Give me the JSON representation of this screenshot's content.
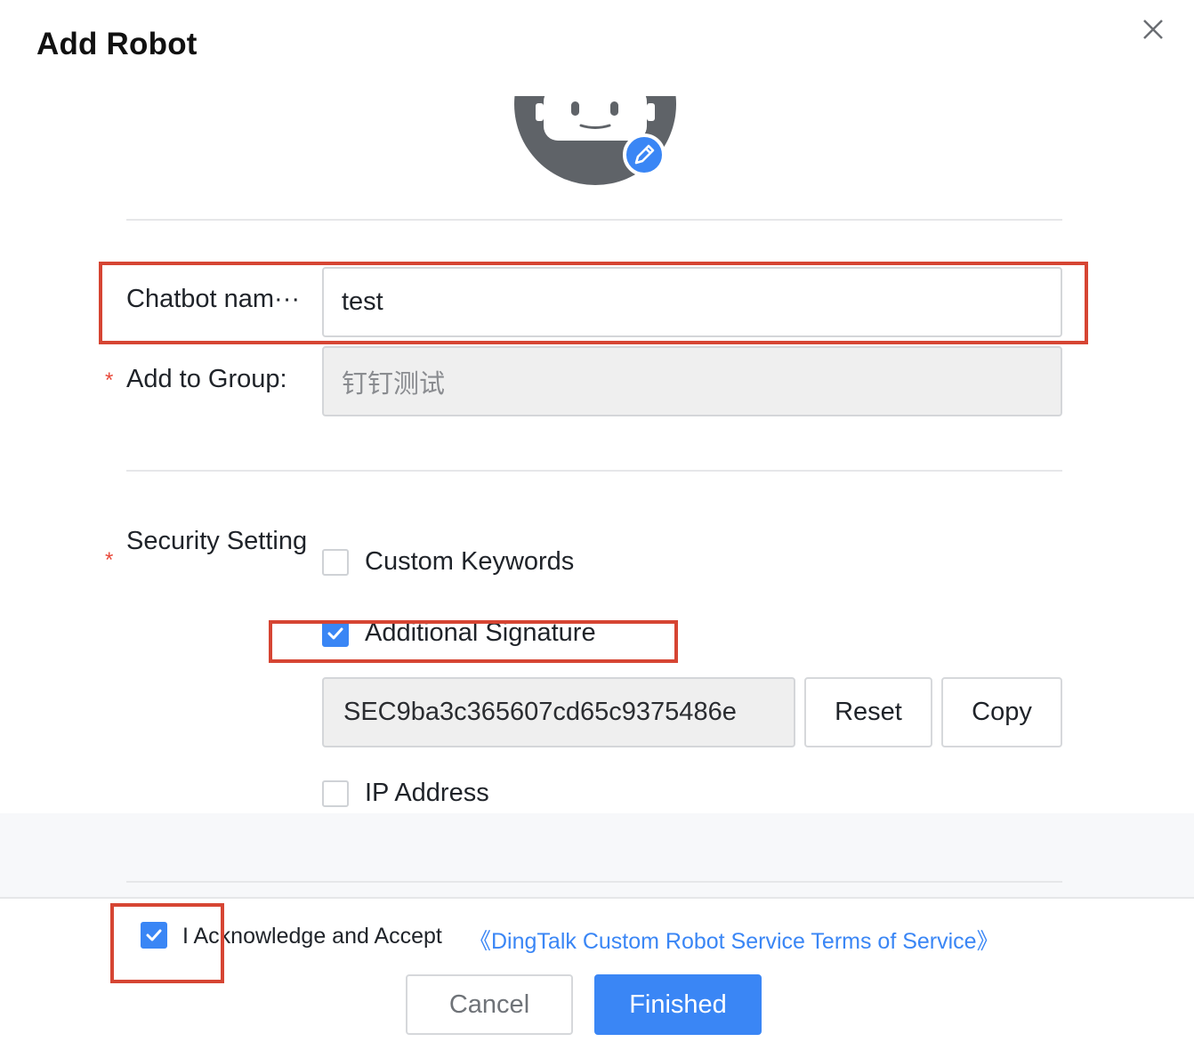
{
  "dialog": {
    "title": "Add Robot",
    "close_icon": "close-icon"
  },
  "avatar": {
    "icon": "robot-avatar-icon",
    "edit_icon": "pencil-icon"
  },
  "form": {
    "name_label": "Chatbot nam···",
    "name_value": "test",
    "group_label": "Add to Group:",
    "group_value": "钉钉测试",
    "security_label": "Security Setting",
    "required_mark": "*"
  },
  "security": {
    "options": [
      {
        "label": "Custom Keywords",
        "checked": false
      },
      {
        "label": "Additional Signature",
        "checked": true
      },
      {
        "label": "IP Address",
        "checked": false
      }
    ],
    "secret_value": "SEC9ba3c365607cd65c9375486e",
    "reset_label": "Reset",
    "copy_label": "Copy"
  },
  "footer": {
    "ack_checked": true,
    "ack_text": "I Acknowledge and Accept",
    "ack_link": "《DingTalk Custom Robot Service Terms of Service》",
    "cancel_label": "Cancel",
    "finish_label": "Finished"
  },
  "colors": {
    "primary": "#3a86f5",
    "required": "#e84a3c",
    "highlight_box": "#d64533"
  }
}
